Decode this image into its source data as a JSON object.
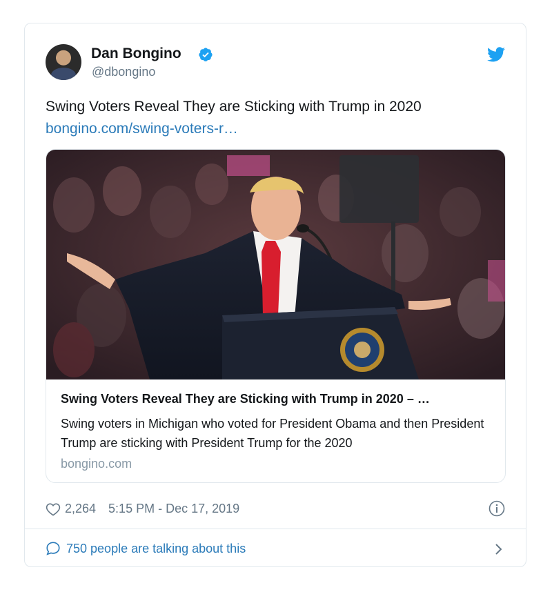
{
  "author": {
    "name": "Dan Bongino",
    "handle": "@dbongino"
  },
  "tweet": {
    "text": "Swing Voters Reveal They are Sticking with Trump in 2020",
    "link": "bongino.com/swing-voters-r…"
  },
  "link_card": {
    "title": "Swing Voters Reveal They are Sticking with Trump in 2020 – …",
    "description": "Swing voters in Michigan who voted for President Obama and then President Trump are sticking with President Trump for the 2020",
    "domain": "bongino.com"
  },
  "meta": {
    "likes": "2,264",
    "timestamp": "5:15 PM - Dec 17, 2019"
  },
  "footer": {
    "talking": "750 people are talking about this"
  },
  "colors": {
    "brand_blue": "#1da1f2",
    "link_blue": "#2b7bb9",
    "muted": "#657786",
    "border": "#e1e8ed"
  },
  "icons": [
    "verified-badge-icon",
    "twitter-bird-icon",
    "heart-icon",
    "info-icon",
    "speech-bubble-icon",
    "chevron-right-icon"
  ]
}
